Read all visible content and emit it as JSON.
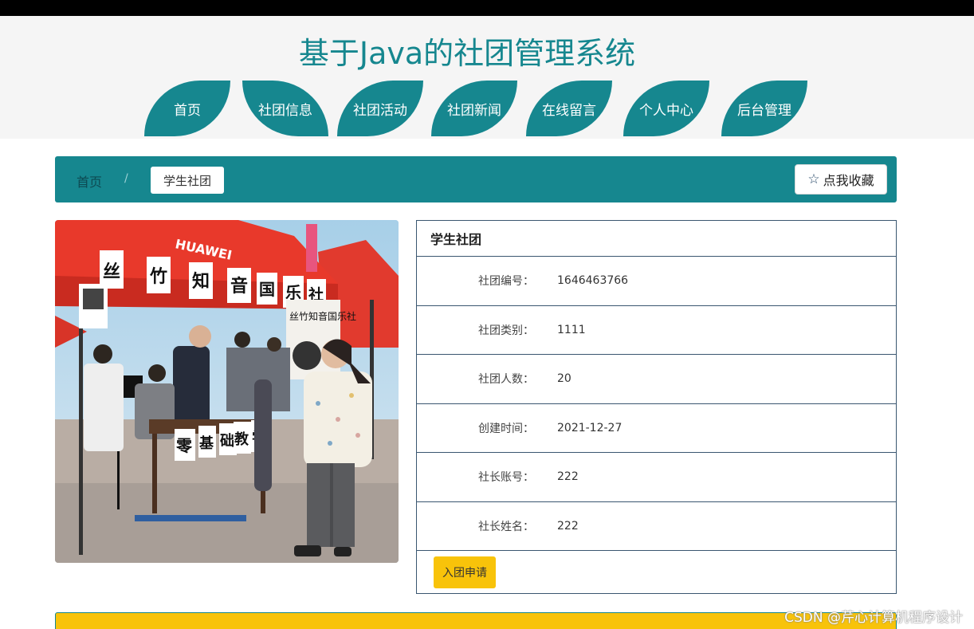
{
  "header": {
    "title": "基于Java的社团管理系统"
  },
  "nav": {
    "items": [
      {
        "label": "首页"
      },
      {
        "label": "社团信息"
      },
      {
        "label": "社团活动"
      },
      {
        "label": "社团新闻"
      },
      {
        "label": "在线留言"
      },
      {
        "label": "个人中心"
      },
      {
        "label": "后台管理"
      }
    ],
    "active": "社团信息"
  },
  "breadcrumb": {
    "home": "首页",
    "separator": "/",
    "current": "学生社团"
  },
  "favorite": {
    "icon": "star-outline-icon",
    "label": "点我收藏"
  },
  "detail": {
    "title": "学生社团",
    "fields": [
      {
        "key": "社团编号：",
        "value": "1646463766"
      },
      {
        "key": "社团类别：",
        "value": "1111"
      },
      {
        "key": "社团人数：",
        "value": "20"
      },
      {
        "key": "创建时间：",
        "value": "2021-12-27"
      },
      {
        "key": "社长账号：",
        "value": "222"
      },
      {
        "key": "社长姓名：",
        "value": "222"
      }
    ],
    "join_label": "入团申请"
  },
  "photo": {
    "banner_chars": [
      "丝",
      "竹",
      "知",
      "音",
      "国",
      "乐",
      "社"
    ],
    "sign_text": "丝竹知音国乐社",
    "table_chars": [
      "零",
      "基",
      "础",
      "教",
      "学"
    ],
    "tent_brand": "HUAWEI"
  },
  "colors": {
    "accent": "#16878f",
    "yellow": "#f8c30a",
    "border": "#3a5670"
  },
  "watermark": "CSDN @芹心计算机程序设计"
}
